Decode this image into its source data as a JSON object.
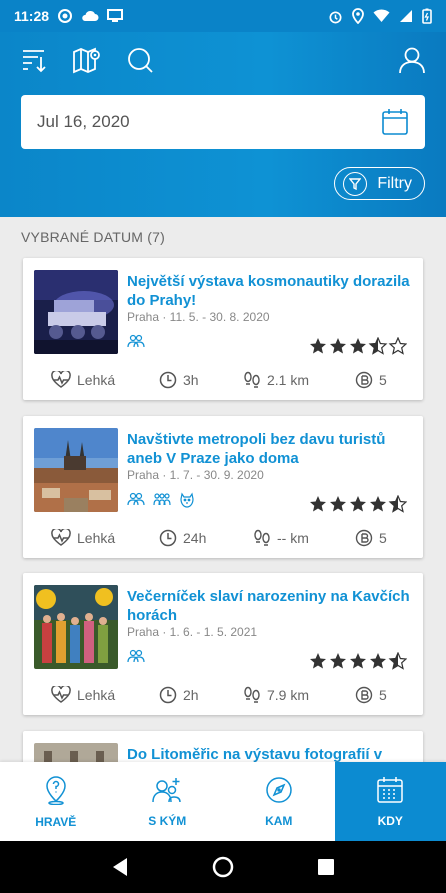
{
  "statusbar": {
    "time": "11:28"
  },
  "header": {
    "date_value": "Jul 16, 2020",
    "filters_label": "Filtry"
  },
  "section": {
    "title": "VYBRANÉ DATUM (7)"
  },
  "cards": [
    {
      "title": "Největší výstava kosmonautiky dorazila do Prahy!",
      "meta": "Praha · 11. 5. - 30. 8. 2020",
      "rating": 3.5,
      "difficulty": "Lehká",
      "duration": "3h",
      "distance": "2.1 km",
      "count": "5"
    },
    {
      "title": "Navštivte metropoli bez davu turistů aneb V Praze jako doma",
      "meta": "Praha · 1. 7. - 30. 9. 2020",
      "rating": 4.5,
      "difficulty": "Lehká",
      "duration": "24h",
      "distance": "-- km",
      "count": "5"
    },
    {
      "title": "Večerníček slaví narozeniny na Kavčích horách",
      "meta": "Praha · 1. 6. - 1. 5. 2021",
      "rating": 4.5,
      "difficulty": "Lehká",
      "duration": "2h",
      "distance": "7.9 km",
      "count": "5"
    },
    {
      "title": "Do Litoměřic na výstavu fotografií v"
    }
  ],
  "bottomnav": {
    "items": [
      {
        "label": "HRAVĚ",
        "icon": "map-pin-icon"
      },
      {
        "label": "S KÝM",
        "icon": "add-people-icon"
      },
      {
        "label": "KAM",
        "icon": "compass-icon"
      },
      {
        "label": "KDY",
        "icon": "calendar-icon",
        "active": true
      }
    ]
  },
  "colors": {
    "accent": "#1191d4",
    "header": "#0b86c9",
    "active_nav": "#0c8bd1"
  }
}
